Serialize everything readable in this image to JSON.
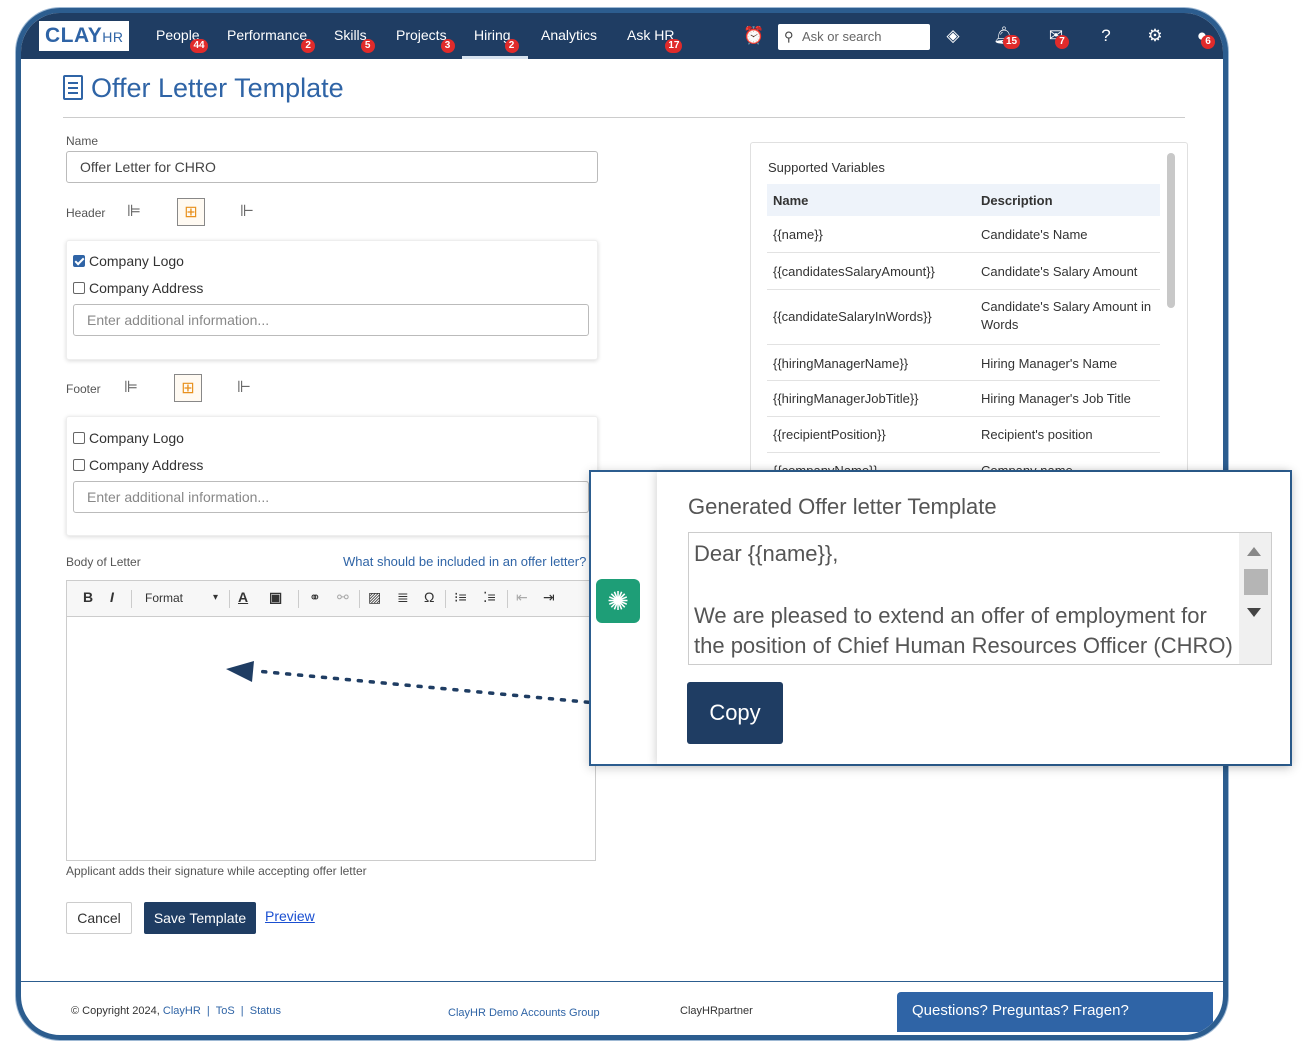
{
  "nav": {
    "logo_main": "CLAY",
    "logo_sub": "HR",
    "items": [
      {
        "label": "People",
        "badge": "44"
      },
      {
        "label": "Performance",
        "badge": "2"
      },
      {
        "label": "Skills",
        "badge": "5"
      },
      {
        "label": "Projects",
        "badge": "3"
      },
      {
        "label": "Hiring",
        "badge": "2"
      },
      {
        "label": "Analytics",
        "badge": ""
      },
      {
        "label": "Ask HR",
        "badge": "17"
      }
    ],
    "search_placeholder": "Ask or search",
    "notifications_badge": "15",
    "messages_badge": "7",
    "profile_badge": "6"
  },
  "page": {
    "title": "Offer Letter Template",
    "name_label": "Name",
    "name_value": "Offer Letter for CHRO",
    "header_label": "Header",
    "footer_label": "Footer",
    "header_options": {
      "company_logo": "Company Logo",
      "company_address": "Company Address",
      "additional_placeholder": "Enter additional information..."
    },
    "footer_options": {
      "company_logo": "Company Logo",
      "company_address": "Company Address",
      "additional_placeholder": "Enter additional information..."
    },
    "body_label": "Body of Letter",
    "body_help_link": "What should be included in an offer letter?",
    "toolbar_format": "Format",
    "signature_note": "Applicant adds their signature while accepting offer letter",
    "cancel_label": "Cancel",
    "save_label": "Save Template",
    "preview_label": "Preview"
  },
  "variables": {
    "title": "Supported Variables",
    "col_name": "Name",
    "col_description": "Description",
    "rows": [
      {
        "name": "{{name}}",
        "description": "Candidate's Name"
      },
      {
        "name": "{{candidatesSalaryAmount}}",
        "description": "Candidate's Salary Amount"
      },
      {
        "name": "{{candidateSalaryInWords}}",
        "description": "Candidate's Salary Amount in Words"
      },
      {
        "name": "{{hiringManagerName}}",
        "description": "Hiring Manager's Name"
      },
      {
        "name": "{{hiringManagerJobTitle}}",
        "description": "Hiring Manager's Job Title"
      },
      {
        "name": "{{recipientPosition}}",
        "description": "Recipient's position"
      },
      {
        "name": "{{companyName}}",
        "description": "Company name"
      }
    ]
  },
  "popup": {
    "title": "Generated Offer letter Template",
    "line1": "Dear {{name}},",
    "line2": "We are pleased to extend an offer of employment for the position of Chief Human Resources Officer (CHRO) at",
    "copy_label": "Copy"
  },
  "footer": {
    "copyright": "© Copyright 2024,",
    "brand_link": "ClayHR",
    "tos": "ToS",
    "status": "Status",
    "sep": "|",
    "group": "ClayHR Demo Accounts Group",
    "partner": "ClayHRpartner",
    "help": "Questions? Preguntas? Fragen?"
  }
}
